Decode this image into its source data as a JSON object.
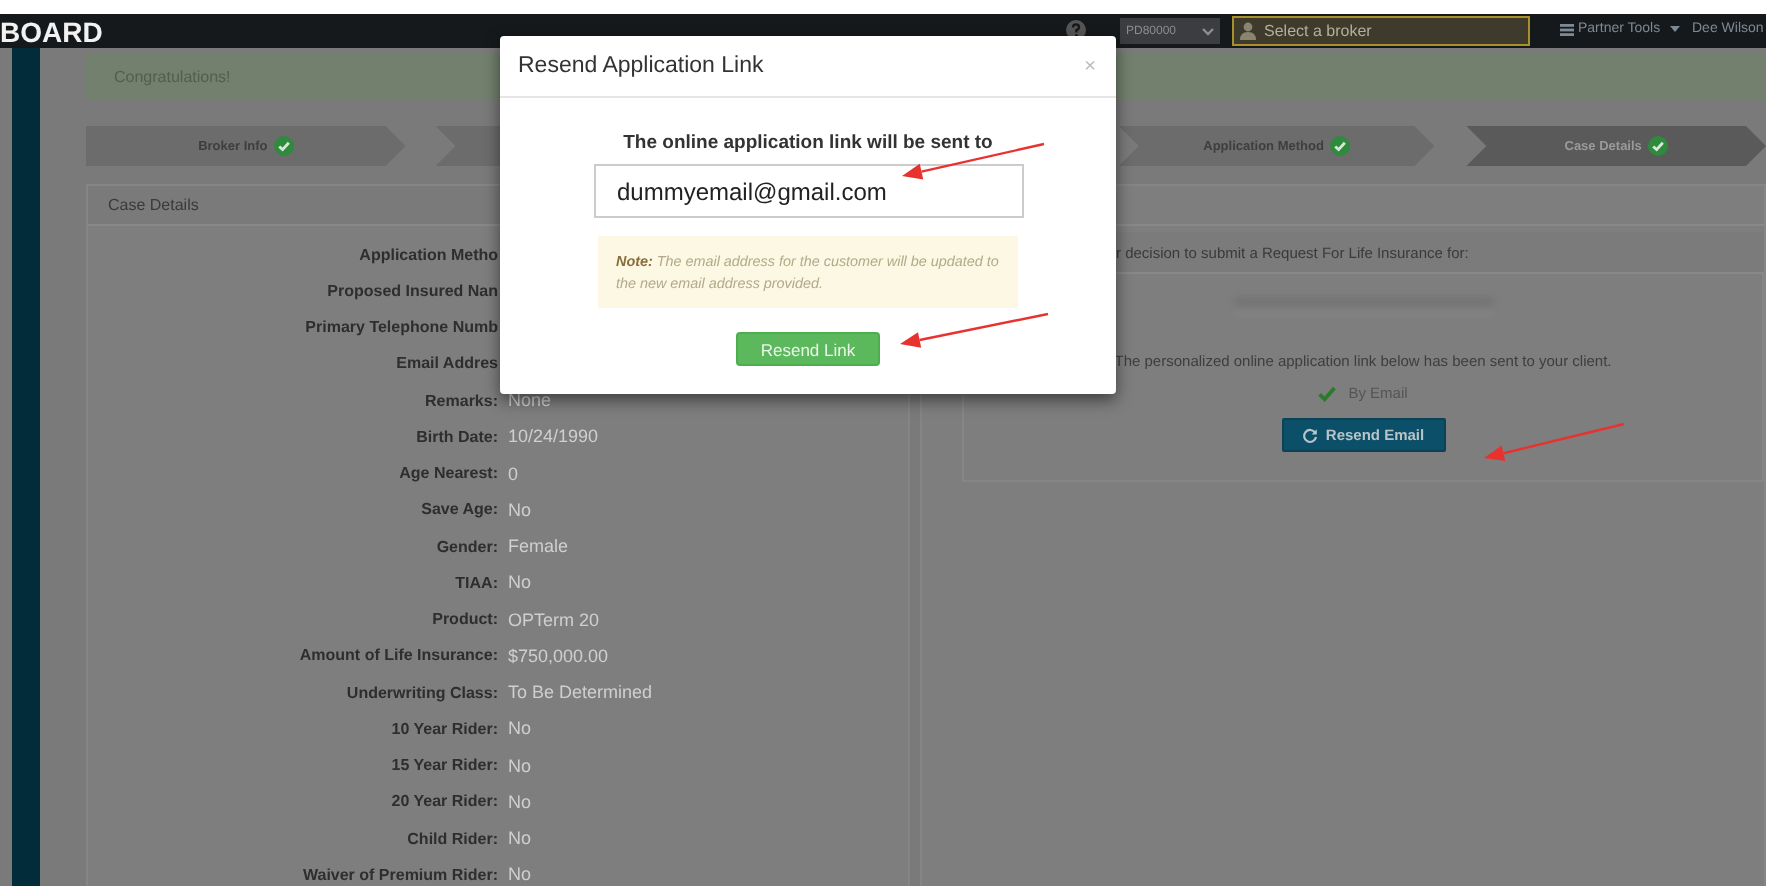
{
  "navbar": {
    "brand": "BOARD",
    "producer_select": {
      "value": "PD80000"
    },
    "broker_field": {
      "placeholder": "Select a broker"
    },
    "menus": [
      {
        "kind": "tools",
        "label": "Partner Tools"
      },
      {
        "kind": "user",
        "label": "Dee Wilson"
      }
    ]
  },
  "alert": {
    "text": "Congratulations!"
  },
  "steps": [
    {
      "label": "Broker Info",
      "complete": true,
      "active": false
    },
    {
      "label": "Application Method",
      "complete": true,
      "active": false
    },
    {
      "label": "Case Details",
      "complete": true,
      "active": true
    }
  ],
  "case_details": {
    "title": "Case Details",
    "rows": [
      {
        "label": "Application Metho"
      },
      {
        "label": "Proposed Insured Nan"
      },
      {
        "label": "Primary Telephone Numb"
      },
      {
        "label": "Email Addres"
      },
      {
        "label": "Remarks:",
        "value": "None"
      },
      {
        "label": "Birth Date:",
        "value": "10/24/1990"
      },
      {
        "label": "Age Nearest:",
        "value": "0"
      },
      {
        "label": "Save Age:",
        "value": "No"
      },
      {
        "label": "Gender:",
        "value": "Female"
      },
      {
        "label": "TIAA:",
        "value": "No"
      },
      {
        "label": "Product:",
        "value": "OPTerm 20"
      },
      {
        "label": "Amount of Life Insurance:",
        "value": "$750,000.00"
      },
      {
        "label": "Underwriting Class:",
        "value": "To Be Determined"
      },
      {
        "label": "10 Year Rider:",
        "value": "No"
      },
      {
        "label": "15 Year Rider:",
        "value": "No"
      },
      {
        "label": "20 Year Rider:",
        "value": "No"
      },
      {
        "label": "Child Rider:",
        "value": "No"
      },
      {
        "label": "Waiver of Premium Rider:",
        "value": "No"
      }
    ]
  },
  "decision_panel": {
    "intro": "r decision to submit a Request For Life Insurance for:",
    "message": "The personalized online application link below has been sent to your client.",
    "channels": [
      {
        "label": "By Email",
        "checked": true
      }
    ],
    "button": "Resend Email"
  },
  "modal": {
    "title": "Resend Application Link",
    "close": "×",
    "prompt": "The online application link will be sent to",
    "email": {
      "value": "dummyemail@gmail.com"
    },
    "note": "**Note:** The email address for the customer will be updated to the new email address provided.",
    "button": "Resend Link"
  }
}
